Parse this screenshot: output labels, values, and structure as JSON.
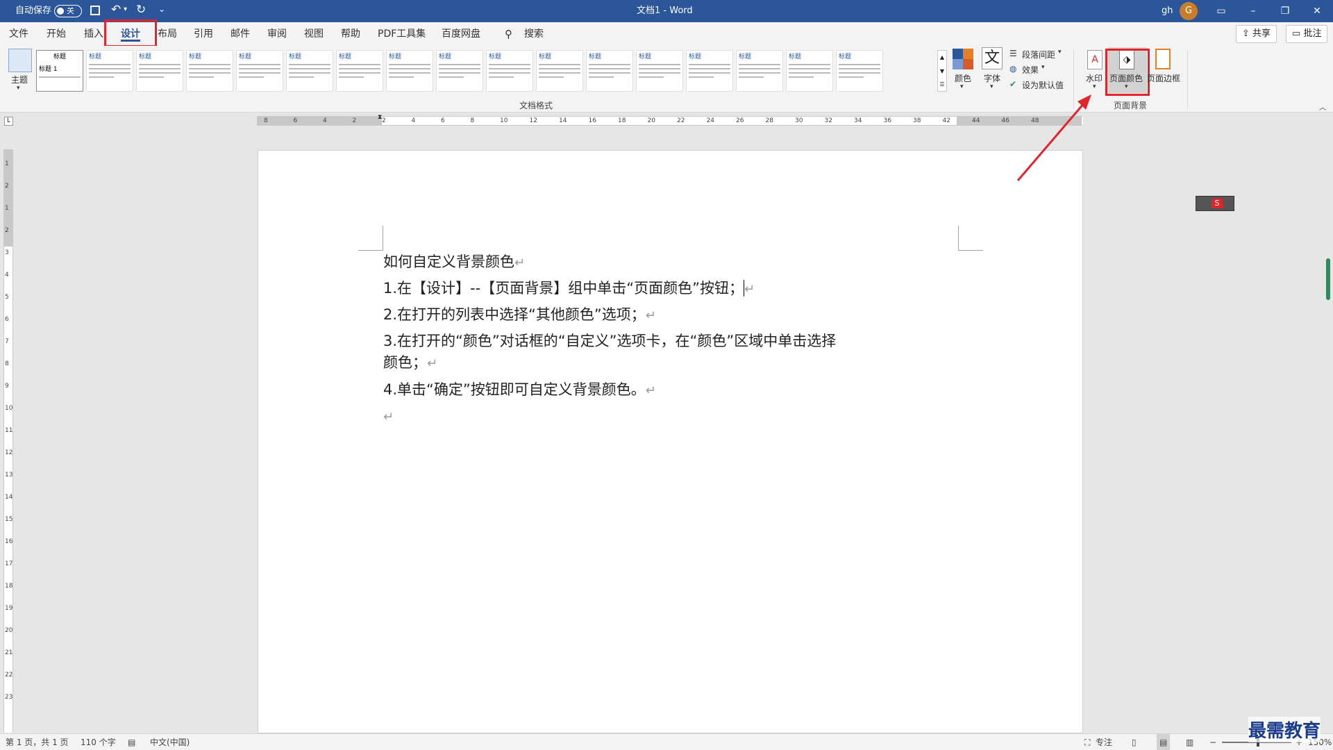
{
  "titlebar": {
    "autosave_label": "自动保存",
    "autosave_state": "关",
    "doc_title": "文档1 - Word",
    "user_initials": "gh",
    "avatar_letter": "G"
  },
  "tabs": [
    "文件",
    "开始",
    "插入",
    "设计",
    "布局",
    "引用",
    "邮件",
    "审阅",
    "视图",
    "帮助",
    "PDF工具集",
    "百度网盘"
  ],
  "active_tab": "设计",
  "search_label": "搜索",
  "share_label": "共享",
  "comment_label": "批注",
  "ribbon": {
    "theme_label": "主题",
    "gallery_titles": [
      "标题",
      "标题",
      "标题",
      "标题",
      "标题",
      "标题",
      "标题",
      "标题",
      "标题",
      "标题",
      "标题",
      "标题",
      "标题",
      "标题",
      "标题",
      "标题",
      "标题"
    ],
    "first_item_text": "标题 1",
    "group_doc_format": "文档格式",
    "colors_label": "颜色",
    "fonts_label": "字体",
    "fonts_glyph": "文",
    "paragraph_spacing_label": "段落间距",
    "effects_label": "效果",
    "set_default_label": "设为默认值",
    "watermark_label": "水印",
    "page_color_label": "页面颜色",
    "page_border_label": "页面边框",
    "group_page_background": "页面背景"
  },
  "ruler": {
    "h_numbers": [
      "8",
      "6",
      "4",
      "2",
      "2",
      "4",
      "6",
      "8",
      "10",
      "12",
      "14",
      "16",
      "18",
      "20",
      "22",
      "24",
      "26",
      "28",
      "30",
      "32",
      "34",
      "36",
      "38",
      "42",
      "44",
      "46",
      "48"
    ],
    "v_numbers": [
      "1",
      "2",
      "1",
      "2",
      "3",
      "4",
      "5",
      "6",
      "7",
      "8",
      "9",
      "10",
      "11",
      "12",
      "13",
      "14",
      "15",
      "16",
      "17",
      "18",
      "19",
      "20",
      "21",
      "22",
      "23"
    ]
  },
  "document": {
    "title": "如何自定义背景颜色",
    "step1": "1.在【设计】--【页面背景】组中单击“页面颜色”按钮；",
    "step2": "2.在打开的列表中选择“其他颜色”选项；",
    "step3_line1": "3.在打开的“颜色”对话框的“自定义”选项卡，在“颜色”区域中单击选择",
    "step3_line2": "颜色；",
    "step4": "4.单击“确定”按钮即可自定义背景颜色。",
    "para_mark": "↵"
  },
  "statusbar": {
    "page_info": "第 1 页，共 1 页",
    "word_count": "110 个字",
    "language": "中文(中国)",
    "focus_label": "专注",
    "zoom": "150%"
  },
  "watermark_brand": "最需教育",
  "colors": {
    "title_bar": "#2b579a",
    "highlight": "#e0242a"
  }
}
